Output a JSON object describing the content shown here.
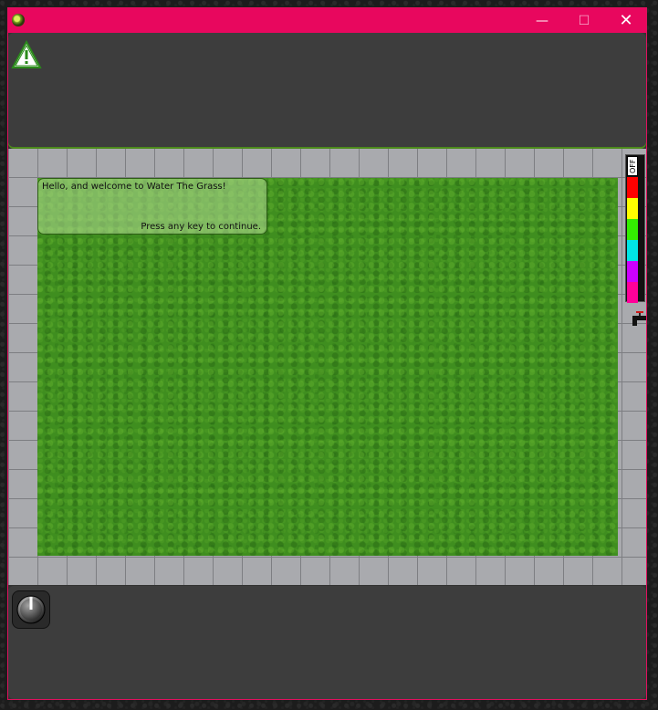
{
  "window": {
    "minimize_glyph": "—",
    "maximize_glyph": "☐",
    "close_glyph": "✕"
  },
  "top_panel": {
    "icon": "warning-icon"
  },
  "dialog": {
    "message": "Hello, and welcome to Water The Grass!",
    "prompt": "Press any key to continue."
  },
  "water_meter": {
    "label": "OFF",
    "colors": [
      "#ff0000",
      "#ffff00",
      "#33ee00",
      "#00e5e5",
      "#cc00ff",
      "#ff0099"
    ]
  },
  "faucet": {
    "icon": "faucet-icon"
  },
  "bottom_panel": {
    "icon": "power-knob-icon"
  }
}
